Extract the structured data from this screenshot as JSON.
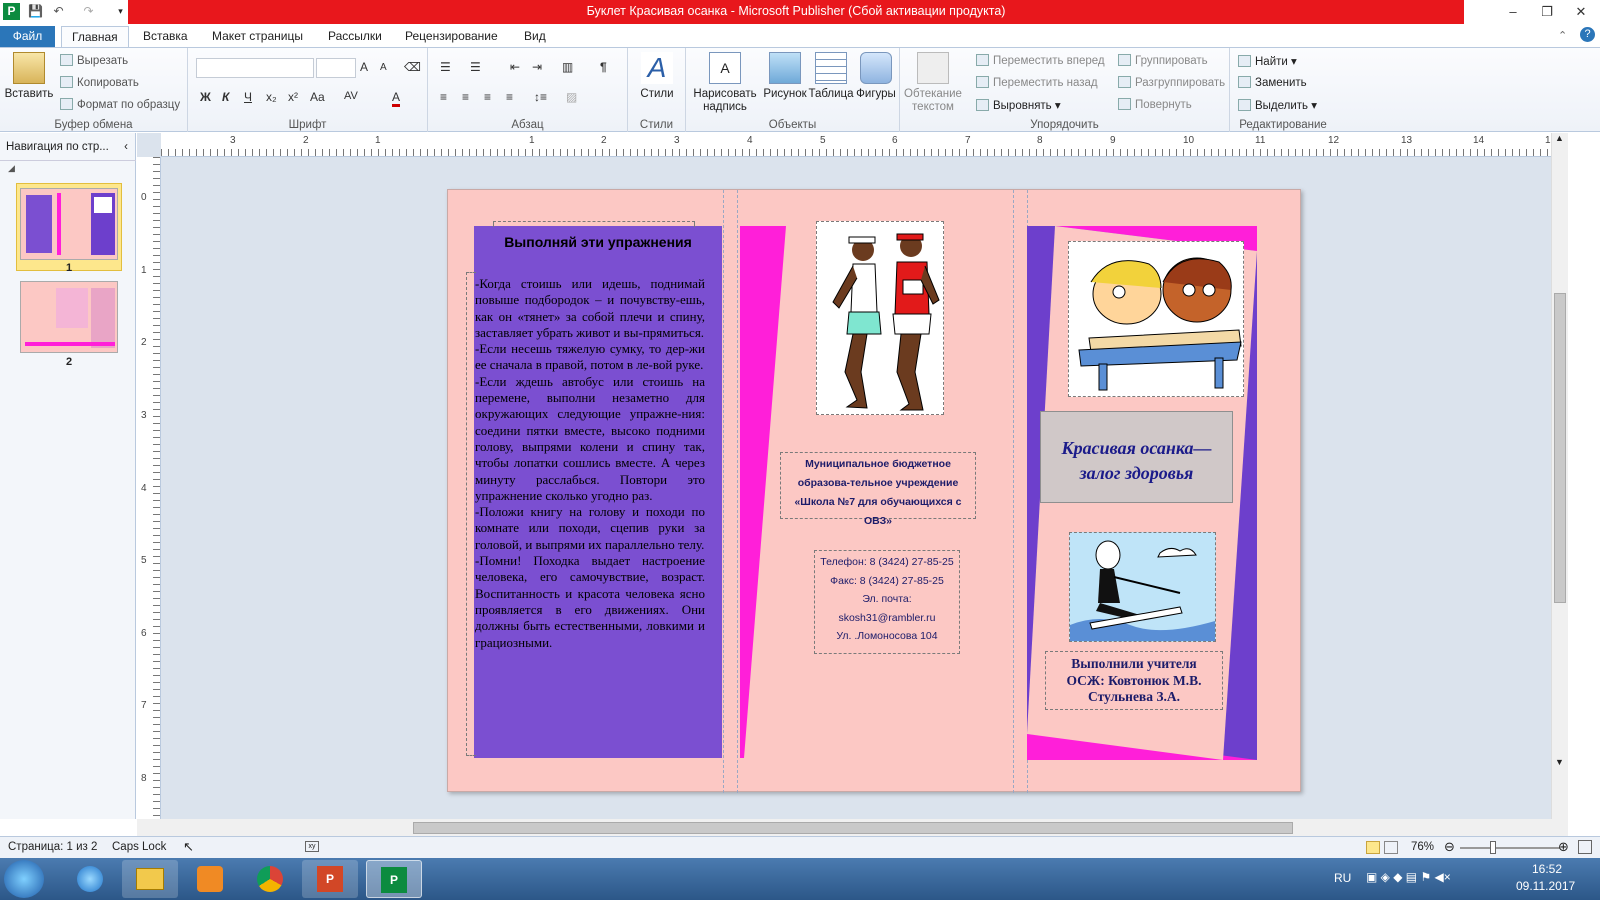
{
  "window": {
    "title": "Буклет Красивая осанка  -  Microsoft Publisher (Сбой активации продукта)"
  },
  "tabs": [
    "Файл",
    "Главная",
    "Вставка",
    "Макет страницы",
    "Рассылки",
    "Рецензирование",
    "Вид"
  ],
  "ribbon": {
    "clipboard": {
      "label": "Буфер обмена",
      "paste": "Вставить",
      "cut": "Вырезать",
      "copy": "Копировать",
      "format_painter": "Формат по образцу"
    },
    "font": {
      "label": "Шрифт",
      "bold": "Ж",
      "italic": "К",
      "underline": "Ч",
      "subscript": "x₂",
      "superscript": "x²",
      "case": "Aa",
      "grow": "A",
      "spacing": "AV",
      "color": "A"
    },
    "paragraph": {
      "label": "Абзац",
      "pilcrow": "¶"
    },
    "styles": {
      "label": "Стили",
      "button": "Стили"
    },
    "objects": {
      "label": "Объекты",
      "draw_text_box": "Нарисовать надпись",
      "picture": "Рисунок",
      "table": "Таблица",
      "shapes": "Фигуры"
    },
    "arrange": {
      "label": "Упорядочить",
      "wrap_text": "Обтекание текстом",
      "bring_forward": "Переместить вперед",
      "send_backward": "Переместить назад",
      "align": "Выровнять",
      "group": "Группировать",
      "ungroup": "Разгруппировать",
      "rotate": "Повернуть"
    },
    "editing": {
      "label": "Редактирование",
      "find": "Найти",
      "replace": "Заменить",
      "select": "Выделить"
    }
  },
  "nav_pane": {
    "title": "Навигация по стр...",
    "pages": [
      "1",
      "2"
    ]
  },
  "ruler": {
    "h": [
      "3",
      "2",
      "1",
      "",
      "1",
      "2",
      "3",
      "4",
      "5",
      "6",
      "7",
      "8",
      "9",
      "10",
      "11",
      "12",
      "13",
      "14",
      "15"
    ],
    "v": [
      "0",
      "1",
      "2",
      "3",
      "4",
      "5",
      "6",
      "7",
      "8"
    ]
  },
  "brochure": {
    "exercises_title": "Выполняй эти упражнения",
    "exercises_text": "-Когда стоишь или идешь, поднимай повыше подбородок – и почувству-ешь, как он «тянет» за собой плечи и спину, заставляет убрать живот и вы-прямиться.\n-Если несешь тяжелую сумку, то дер-жи ее сначала в правой, потом в ле-вой руке.\n-Если ждешь автобус или стоишь на перемене, выполни незаметно для окружающих следующие упражне-ния: соедини пятки вместе, высоко подними голову, выпрями колени и спину так, чтобы лопатки сошлись вместе. А через минуту расслабься. Повтори это упражнение сколько угодно раз.\n-Положи книгу на голову и походи по комнате или походи, сцепив руки за головой, и выпрями их параллельно телу.\n-Помни! Походка выдает настроение человека, его самочувствие, возраст. Воспитанность и красота человека ясно проявляется в его движениях. Они должны быть естественными, ловкими и грациозными.",
    "school": "Муниципальное бюджетное образова-тельное учреждение «Школа №7 для обучающихся с ОВЗ»",
    "contacts": [
      "Телефон: 8 (3424) 27-85-25",
      "Факс: 8 (3424) 27-85-25",
      "Эл. почта:",
      "skosh31@rambler.ru",
      "Ул. .Ломоносова 104"
    ],
    "title_line1": "Красивая осанка—",
    "title_line2": "залог здоровья",
    "authors": [
      "Выполнили учителя",
      "ОСЖ: Ковтонюк М.В.",
      "Стульнева З.А."
    ]
  },
  "status": {
    "page": "Страница: 1 из 2",
    "caps": "Caps Lock",
    "zoom": "76%"
  },
  "taskbar": {
    "lang": "RU",
    "time": "16:52",
    "date": "09.11.2017"
  },
  "colors": {
    "title_red": "#e8171c",
    "page_pink": "#fcc8c4",
    "purple": "#7b4fd1",
    "magenta": "#ff1fd9",
    "navy": "#1c1c6a"
  }
}
